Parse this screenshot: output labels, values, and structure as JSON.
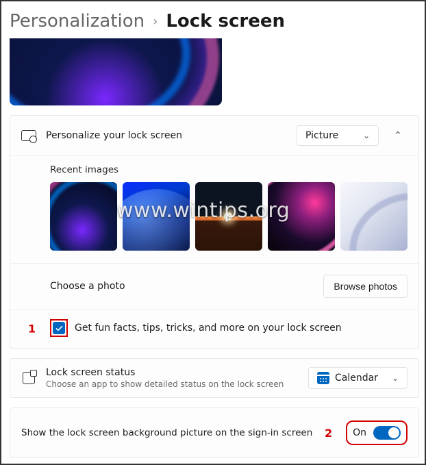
{
  "breadcrumb": {
    "parent": "Personalization",
    "current": "Lock screen"
  },
  "personalize": {
    "label": "Personalize your lock screen",
    "dropdown": "Picture"
  },
  "recent_images_title": "Recent images",
  "choose_photo_label": "Choose a photo",
  "browse_button": "Browse photos",
  "fun_facts_label": "Get fun facts, tips, tricks, and more on your lock screen",
  "fun_facts_checked": true,
  "status": {
    "title": "Lock screen status",
    "subtitle": "Choose an app to show detailed status on the lock screen",
    "app": "Calendar"
  },
  "signin": {
    "label": "Show the lock screen background picture on the sign-in screen",
    "toggle_label": "On",
    "toggle_on": true
  },
  "annotations": {
    "one": "1",
    "two": "2"
  },
  "watermark": "www.wintips.org"
}
